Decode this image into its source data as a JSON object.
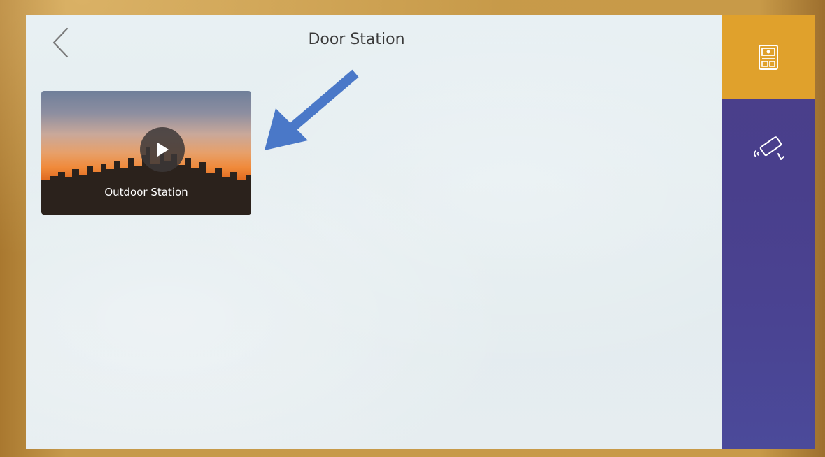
{
  "header": {
    "title": "Door Station",
    "back_icon": "chevron-left-icon"
  },
  "tiles": [
    {
      "label": "Outdoor Station",
      "icon": "play-icon"
    }
  ],
  "annotation": {
    "icon": "arrow-icon",
    "color": "#4a78c8"
  },
  "sidebar": {
    "items": [
      {
        "icon": "door-station-icon",
        "active": true,
        "color": "#e0a12c"
      },
      {
        "icon": "camera-icon",
        "active": false
      }
    ],
    "color": "#4a3f8a"
  }
}
